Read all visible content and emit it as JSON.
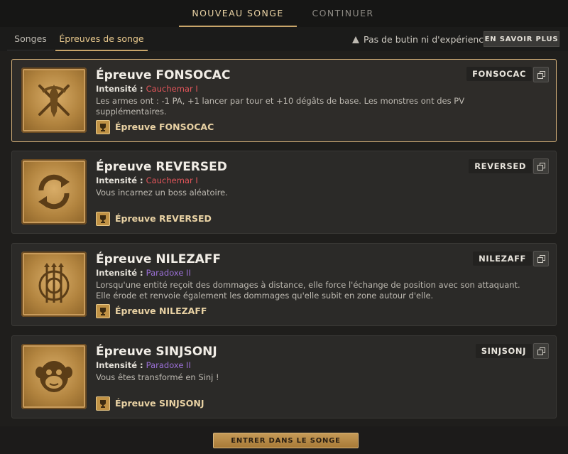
{
  "top_tabs": {
    "new_dream": "NOUVEAU SONGE",
    "continue": "CONTINUER"
  },
  "sub_tabs": {
    "dreams": "Songes",
    "trials": "Épreuves de songe"
  },
  "info": {
    "text": "Pas de butin ni d'expérience",
    "learn_more": "EN SAVOIR PLUS",
    "icon": "warning-icon"
  },
  "intensity_label": "Intensité :",
  "cards": [
    {
      "title": "Épreuve FONSOCAC",
      "intensity": "Cauchemar I",
      "intensity_color": "#e2555a",
      "description": "Les armes ont : -1 PA, +1 lancer par tour et +10 dégâts de base. Les monstres ont des PV supplémentaires.",
      "reward": "Épreuve FONSOCAC",
      "code": "FONSOCAC",
      "icon": "crossed-swords-icon"
    },
    {
      "title": "Épreuve REVERSED",
      "intensity": "Cauchemar I",
      "intensity_color": "#e2555a",
      "description": "Vous incarnez un boss aléatoire.",
      "reward": "Épreuve REVERSED",
      "code": "REVERSED",
      "icon": "cycle-arrows-icon"
    },
    {
      "title": "Épreuve NILEZAFF",
      "intensity": "Paradoxe II",
      "intensity_color": "#9b6fd6",
      "description": "Lorsqu'une entité reçoit des dommages à distance, elle force l'échange de position avec son attaquant. Elle érode et renvoie également les dommages qu'elle subit en zone autour d'elle.",
      "reward": "Épreuve NILEZAFF",
      "code": "NILEZAFF",
      "icon": "arrows-target-icon"
    },
    {
      "title": "Épreuve SINJSONJ",
      "intensity": "Paradoxe II",
      "intensity_color": "#9b6fd6",
      "description": "Vous êtes transformé en Sinj !",
      "reward": "Épreuve SINJSONJ",
      "code": "SINJSONJ",
      "icon": "monkey-face-icon"
    }
  ],
  "enter_button": "ENTRER DANS LE SONGE"
}
